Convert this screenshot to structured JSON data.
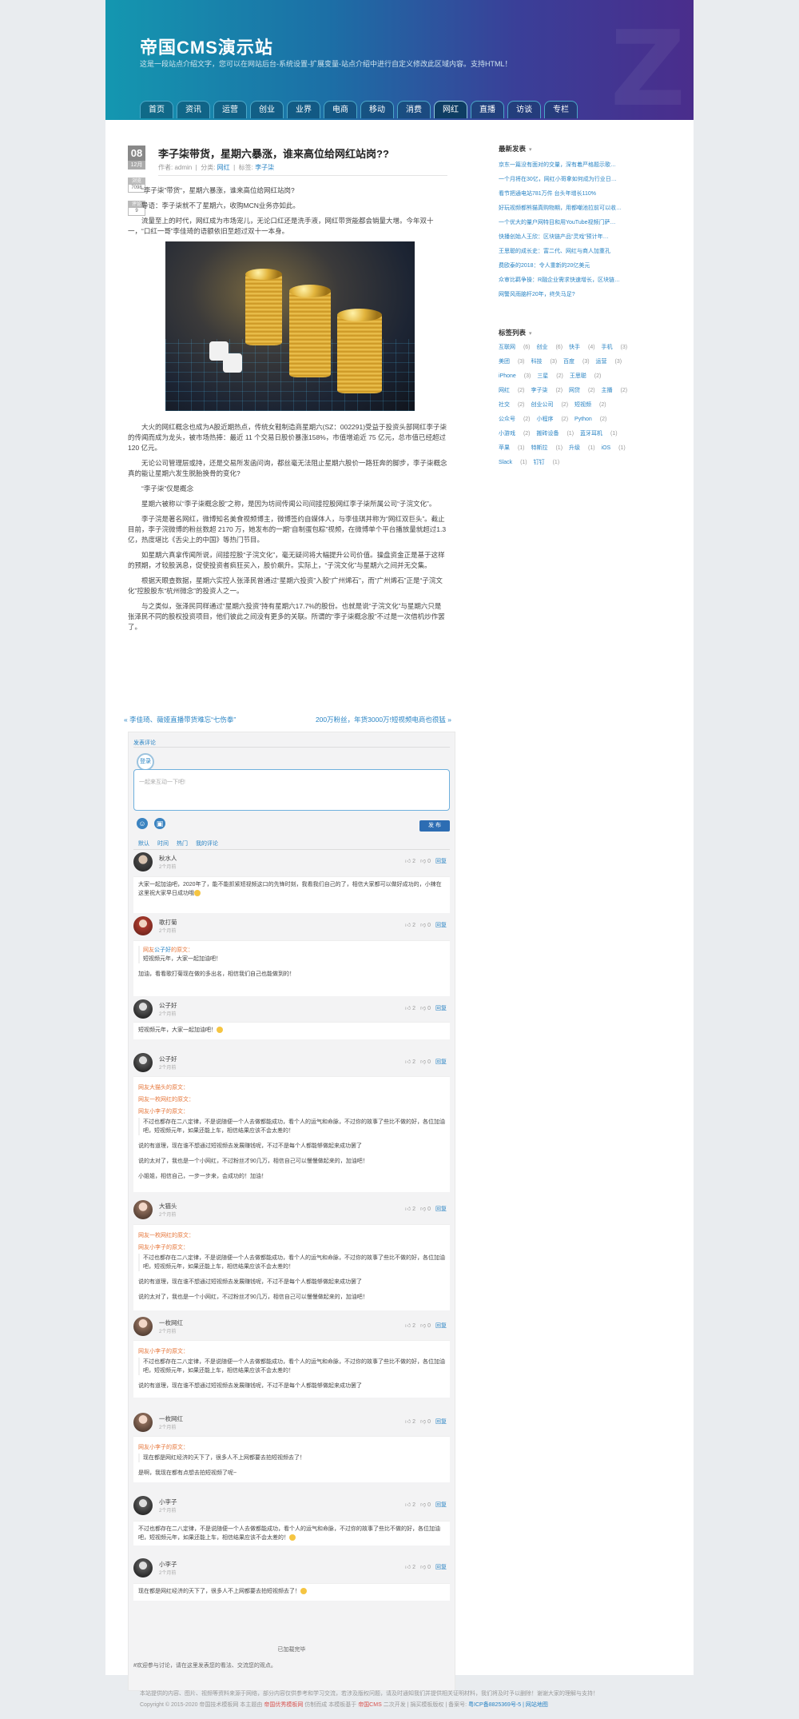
{
  "site": {
    "title": "帝国CMS演示站",
    "desc": "这是一段站点介绍文字，您可以在网站后台-系统设置-扩展变量-站点介绍中进行自定义修改此区域内容。支持HTML！"
  },
  "nav": [
    "首页",
    "资讯",
    "运营",
    "创业",
    "业界",
    "电商",
    "移动",
    "消费",
    "网红",
    "直播",
    "访谈",
    "专栏"
  ],
  "nav_active": "网红",
  "article": {
    "day": "08",
    "month": "12月",
    "views_label": "浏览",
    "views": "7098",
    "comments_label": "评论",
    "comments": "9",
    "title": "李子柒带货，星期六暴涨，谁来高位给网红站岗??",
    "meta": {
      "author": "作者: admin",
      "category_label": "分类:",
      "category": "网红",
      "tags_label": "标签:",
      "tag": "李子柒"
    },
    "paras1": [
      "“李子柒”带货“，星期六暴涨，谁来高位给网红站岗?",
      "导语：李子柒就不了星期六，收购MCN业务亦如此。",
      "流量至上的时代，网红成为市场宠儿，无论口红还是洗手液，网红带货能都会销量大增。今年双十一，“口红一哥”李佳琦的语额依旧至超过双十一本身。"
    ],
    "paras2": [
      "大火的网红概念也成为A股近期热点，传统女鞋制造商星期六(SZ：002291)受益于投资头部网红李子柒的传闻而成为龙头，被市场热捧：最近 11 个交易日股价暴涨158%，市值增逾近 75 亿元，总市值已经超过 120 亿元。",
      "无论公司管理层或持，还是交易所发函问询，都丝毫无法阻止星期六股价一路狂奔的脚步，李子柒概念真的能让星期六发生脱胎换骨的变化?",
      "“李子柒”仅是概念",
      "星期六被称以“李子柒概念股”之称，是因为坊间传闻公司间接控股网红李子柒所属公司“子浣文化”。",
      "李子浣是著名网红，微博知名美食视频博主，微博签约自媒体人，与李佳琪并称为“网红双巨头”。截止目前，李子浣微博的粉丝数超 2170 万，她发布的一期“自制蛋包粽”视频，在微博单个平台播放量就超过1.3亿，热度堪比《舌尖上的中国》等热门节目。",
      "如星期六真拿传闻所说，间接控股“子浣文化”，毫无疑问将大幅提升公司价值。操盘资金正是基于这样的预期，才较股涡息，促使投资者疯狂买入，股价飙升。实际上，“子浣文化”与星期六之间并无交集。",
      "根据天眼查数据，星期六实控人张泽民曾通过“星期六投资”入股“广州烯石”，而“广州烯石”正是“子浣文化”控股股东“杭州微念”的投资人之一。",
      "与之类似，张泽民同样通过“星期六投资”持有星期六17.7%的股份。也就是说“子浣文化”与星期六只是张泽民不同的股权投资项目，他们彼此之间没有更多的关联。所谓的“李子柒概念股”不过是一次借机炒作罢了。"
    ],
    "prev": "« 李佳琦、薇娅直播带货难忘“七伤拳”",
    "next": "200万粉丝，年货3000万!短视频电商也很猛 »"
  },
  "comments": {
    "head": "发表评论",
    "login": "登录",
    "placeholder": "一起来互动一下吧!",
    "emoji1": "☺",
    "emoji2": "▣",
    "publish": "发 布",
    "tabs": [
      "默认",
      "时间",
      "热门",
      "我的评论"
    ],
    "items": [
      {
        "name": "秋水人",
        "time": "2个月前",
        "likes": "2",
        "dislikes": "0",
        "reply": "回复",
        "text": "大家一起加油吧，2020年了，能不能抓紧短视频这口的先锋时刻，我看我们自己的了，相信大家都可以做好成功的，小辣在这里祝大家早日成功哦"
      },
      {
        "name": "歌打菊",
        "time": "2个月前",
        "likes": "2",
        "dislikes": "0",
        "reply": "回复",
        "qname": "公子好",
        "qlabel": "网友",
        "qsuffix": "的原文：",
        "qtext": "短视频元年，大家一起加油吧！",
        "text": "加油，看看歌打菊现在做的多出名，相信我们自己也能做到的！"
      },
      {
        "name": "公子好",
        "time": "2个月前",
        "likes": "2",
        "dislikes": "0",
        "reply": "回复",
        "text": "短视频元年，大家一起加油吧！"
      },
      {
        "name": "公子好",
        "time": "2个月前",
        "likes": "2",
        "dislikes": "0",
        "reply": "回复",
        "q1": "网友大猫头的原文：",
        "q2": "网友一枚网红的原文：",
        "q3": "网友小李子的原文：",
        "q3text": "不过也都存在二八定律，不是说随便一个人去做都能成功，看个人的运气和命脉，不过你的故事了些比不做的好，各位加油吧，短视频元年，如果还能上车，相信结果应该不会太差的！",
        "t2": "说的有道理，现在谁不想通过短视频去发展赚钱呢，不过不是每个人都能够做起来成功罢了",
        "t3": "说的太对了，我也是一个小网红，不过粉丝才90几万，相信自己可以慢慢做起来的，加油吧！",
        "t4": "小姐姐，相信自己，一步一步来，会成功的！加油！"
      },
      {
        "name": "大猫头",
        "time": "2个月前",
        "likes": "2",
        "dislikes": "0",
        "reply": "回复",
        "q1": "网友一枚网红的原文：",
        "q2": "网友小李子的原文：",
        "q2text": "不过也都存在二八定律，不是说随便一个人去做都能成功，看个人的运气和命脉，不过你的故事了些比不做的好，各位加油吧，短视频元年，如果还能上车，相信结果应该不会太差的！",
        "t2": "说的有道理，现在谁不想通过短视频去发展赚钱呢，不过不是每个人都能够做起来成功罢了",
        "t3": "说的太对了，我也是一个小网红，不过粉丝才90几万，相信自己可以慢慢做起来的，加油吧！"
      },
      {
        "name": "一枚网红",
        "time": "2个月前",
        "likes": "2",
        "dislikes": "0",
        "reply": "回复",
        "q1": "网友小李子的原文：",
        "q1text": "不过也都存在二八定律，不是说随便一个人去做都能成功，看个人的运气和命脉，不过你的故事了些比不做的好，各位加油吧，短视频元年，如果还能上车，相信结果应该不会太差的！",
        "t2": "说的有道理，现在谁不想通过短视频去发展赚钱呢，不过不是每个人都能够做起来成功罢了"
      },
      {
        "name": "一枚网红",
        "time": "2个月前",
        "likes": "2",
        "dislikes": "0",
        "reply": "回复",
        "q1": "网友小李子的原文：",
        "q1text": "现在都是网红经济的天下了，很多人不上网都要去拍短视频去了！",
        "t2": "是啊，我现在都有点想去拍短视频了呢~"
      },
      {
        "name": "小李子",
        "time": "2个月前",
        "likes": "2",
        "dislikes": "0",
        "reply": "回复",
        "text": "不过也都存在二八定律，不是说随便一个人去做都能成功，看个人的运气和命脉，不过你的故事了些比不做的好，各位加油吧，短视频元年，如果还能上车，相信结果应该不会太差的！"
      },
      {
        "name": "小李子",
        "time": "2个月前",
        "likes": "2",
        "dislikes": "0",
        "reply": "回复",
        "text": "现在都是网红经济的天下了，很多人不上网都要去拍短视频去了！"
      }
    ],
    "loaded": "已加载完毕",
    "foot": "#欢迎参与讨论，请在这里发表您的看法、交流您的观点。"
  },
  "sidebar": {
    "recent_title": "最新发表",
    "recent": [
      "京东一篇没有面对的交量，深有着严格题示歌…",
      "一个月将在30亿，网红小哥拿如何成为行业日…",
      "看节把通电站781万件 台头年增长110%",
      "好玩视频都熊猫真购物期，用都嘲池拉前可以收…",
      "一个优大的量户网特目和用YouTube视频门萨…",
      "快播创始人王欣：区块链产品“灵戏”预计年…",
      "王思聪的成长史：富二代、网红与商人加重孔",
      "费欧泰的2018：令人重新的20亿美元",
      "众审比羁争操：R融企业需求快速增长，区块链…",
      "网警风雨脑杆20年，终失马足?"
    ],
    "tags_title": "标签列表",
    "tags": [
      {
        "n": "互联网",
        "c": "(6)"
      },
      {
        "n": "创业",
        "c": "(6)"
      },
      {
        "n": "快手",
        "c": "(4)"
      },
      {
        "n": "手机",
        "c": "(3)"
      },
      {
        "n": "美团",
        "c": "(3)"
      },
      {
        "n": "科技",
        "c": "(3)"
      },
      {
        "n": "百度",
        "c": "(3)"
      },
      {
        "n": "运营",
        "c": "(3)"
      },
      {
        "n": "iPhone",
        "c": "(3)"
      },
      {
        "n": "三星",
        "c": "(2)"
      },
      {
        "n": "王思聪",
        "c": "(2)"
      },
      {
        "n": "网红",
        "c": "(2)"
      },
      {
        "n": "李子柒",
        "c": "(2)"
      },
      {
        "n": "网贷",
        "c": "(2)"
      },
      {
        "n": "主播",
        "c": "(2)"
      },
      {
        "n": "社交",
        "c": "(2)"
      },
      {
        "n": "创业公司",
        "c": "(2)"
      },
      {
        "n": "短视频",
        "c": "(2)"
      },
      {
        "n": "公众号",
        "c": "(2)"
      },
      {
        "n": "小程序",
        "c": "(2)"
      },
      {
        "n": "Python",
        "c": "(2)"
      },
      {
        "n": "小游戏",
        "c": "(2)"
      },
      {
        "n": "搬砖设备",
        "c": "(1)"
      },
      {
        "n": "蓝牙耳机",
        "c": "(1)"
      },
      {
        "n": "苹果",
        "c": "(1)"
      },
      {
        "n": "特斯拉",
        "c": "(1)"
      },
      {
        "n": "升级",
        "c": "(1)"
      },
      {
        "n": "iOS",
        "c": "(1)"
      },
      {
        "n": "Slack",
        "c": "(1)"
      },
      {
        "n": "钉钉",
        "c": "(1)"
      }
    ]
  },
  "footer": {
    "line1": "本站提供的内容、图片、视频等资料来源于网络，部分内容仅供参考和学习交流，若涉及版权问题，请及时通知我们并提供相关证明材料，我们将及时予以删除！谢谢大家的理解与支持！",
    "line2a": "Copyright © 2015-2020 帝国技术模板网 本主题由",
    "line2b": "帝国优秀模板网",
    "line2c": "仿制而成 本模板基于",
    "line2d": "帝国CMS",
    "line2e": "二次开发 | 捐买模板版权 | 备案号:",
    "line2f": "粤ICP备8825369号-5 | 网站地图"
  }
}
